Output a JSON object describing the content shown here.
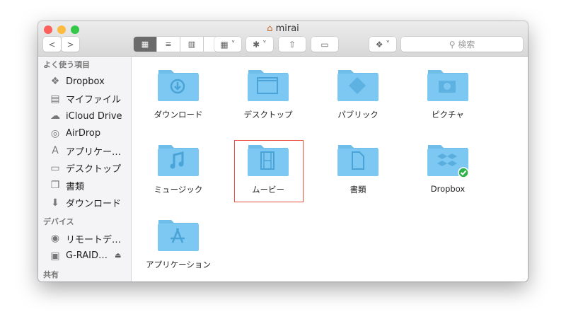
{
  "window": {
    "title": "mirai"
  },
  "toolbar": {
    "back": "<",
    "forward": ">",
    "search_placeholder": "検索"
  },
  "sidebar": {
    "sections": [
      {
        "header": "よく使う項目",
        "items": [
          {
            "label": "Dropbox",
            "icon": "dropbox-icon",
            "glyph": "❖"
          },
          {
            "label": "マイファイル",
            "icon": "all-files-icon",
            "glyph": "▤"
          },
          {
            "label": "iCloud Drive",
            "icon": "cloud-icon",
            "glyph": "☁"
          },
          {
            "label": "AirDrop",
            "icon": "airdrop-icon",
            "glyph": "◎"
          },
          {
            "label": "アプリケー…",
            "icon": "applications-icon",
            "glyph": "A"
          },
          {
            "label": "デスクトップ",
            "icon": "desktop-icon",
            "glyph": "▭"
          },
          {
            "label": "書類",
            "icon": "documents-icon",
            "glyph": "❐"
          },
          {
            "label": "ダウンロード",
            "icon": "downloads-icon",
            "glyph": "⬇"
          }
        ]
      },
      {
        "header": "デバイス",
        "items": [
          {
            "label": "リモートデ…",
            "icon": "remote-disc-icon",
            "glyph": "◉"
          },
          {
            "label": "G-RAID…",
            "icon": "drive-icon",
            "glyph": "▣",
            "eject": "⏏"
          }
        ]
      },
      {
        "header": "共有",
        "items": []
      }
    ]
  },
  "folders": [
    {
      "label": "ダウンロード",
      "emblem": "download"
    },
    {
      "label": "デスクトップ",
      "emblem": "desktop"
    },
    {
      "label": "パブリック",
      "emblem": "public"
    },
    {
      "label": "ピクチャ",
      "emblem": "camera"
    },
    {
      "label": "ミュージック",
      "emblem": "music"
    },
    {
      "label": "ムービー",
      "emblem": "film",
      "selected": true
    },
    {
      "label": "書類",
      "emblem": "document"
    },
    {
      "label": "Dropbox",
      "emblem": "dropbox",
      "synced": true
    },
    {
      "label": "アプリケーション",
      "emblem": "apps"
    }
  ],
  "colors": {
    "folder": "#7cc8f2",
    "selection": "#e8503a",
    "sync": "#2db34a"
  }
}
